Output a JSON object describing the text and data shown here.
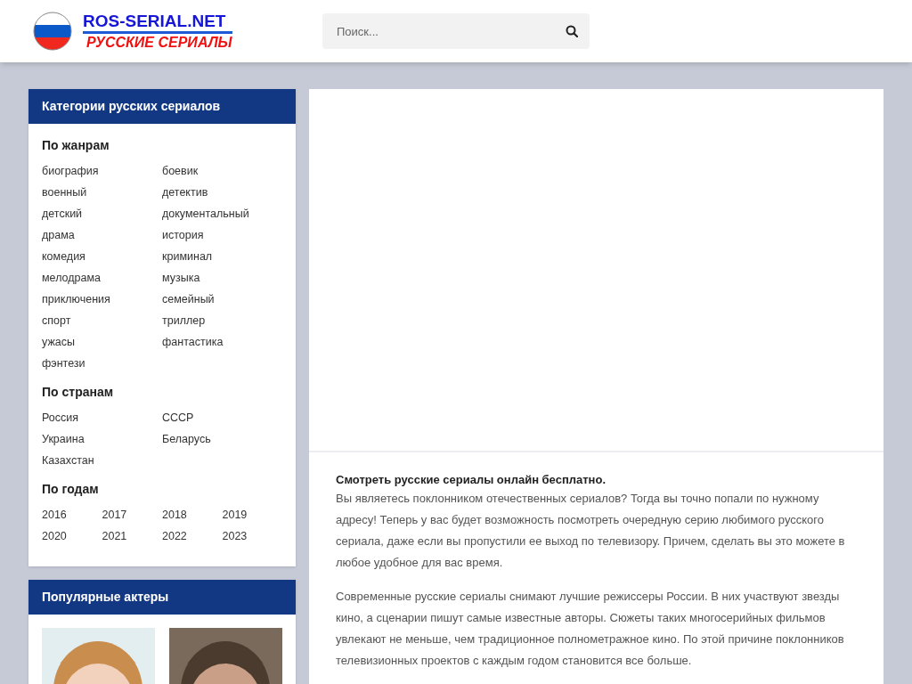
{
  "header": {
    "logo": {
      "title": "ROS-SERIAL.NET",
      "subtitle": "РУССКИЕ СЕРИАЛЫ"
    },
    "search": {
      "placeholder": "Поиск..."
    }
  },
  "sidebar": {
    "categories": {
      "title": "Категории русских сериалов",
      "groups": [
        {
          "title": "По жанрам",
          "kind": "two-column",
          "items": [
            "биография",
            "боевик",
            "военный",
            "детектив",
            "детский",
            "документальный",
            "драма",
            "история",
            "комедия",
            "криминал",
            "мелодрама",
            "музыка",
            "приключения",
            "семейный",
            "спорт",
            "триллер",
            "ужасы",
            "фантастика",
            "фэнтези"
          ]
        },
        {
          "title": "По странам",
          "kind": "two-column",
          "items": [
            "Россия",
            "СССР",
            "Украина",
            "Беларусь",
            "Казахстан"
          ]
        },
        {
          "title": "По годам",
          "kind": "four-column",
          "items": [
            "2016",
            "2017",
            "2018",
            "2019",
            "2020",
            "2021",
            "2022",
            "2023"
          ]
        }
      ]
    },
    "actors": {
      "title": "Популярные актеры"
    }
  },
  "main": {
    "intro": {
      "heading": "Смотреть русские сериалы онлайн бесплатно.",
      "paragraphs": [
        "Вы являетесь поклонником отечественных сериалов? Тогда вы точно попали по нужному адресу! Теперь у вас будет возможность посмотреть очередную серию любимого русского сериала, даже если вы пропустили ее выход по телевизору. Причем, сделать вы это можете в любое удобное для вас время.",
        "Современные русские сериалы снимают лучшие режиссеры России. В них участвуют звезды кино, а сценарии пишут самые известные авторы. Сюжеты таких многосерийных фильмов увлекают не меньше, чем традиционное полнометражное кино. По этой причине поклонников телевизионных проектов с каждым годом становится все больше."
      ]
    }
  }
}
